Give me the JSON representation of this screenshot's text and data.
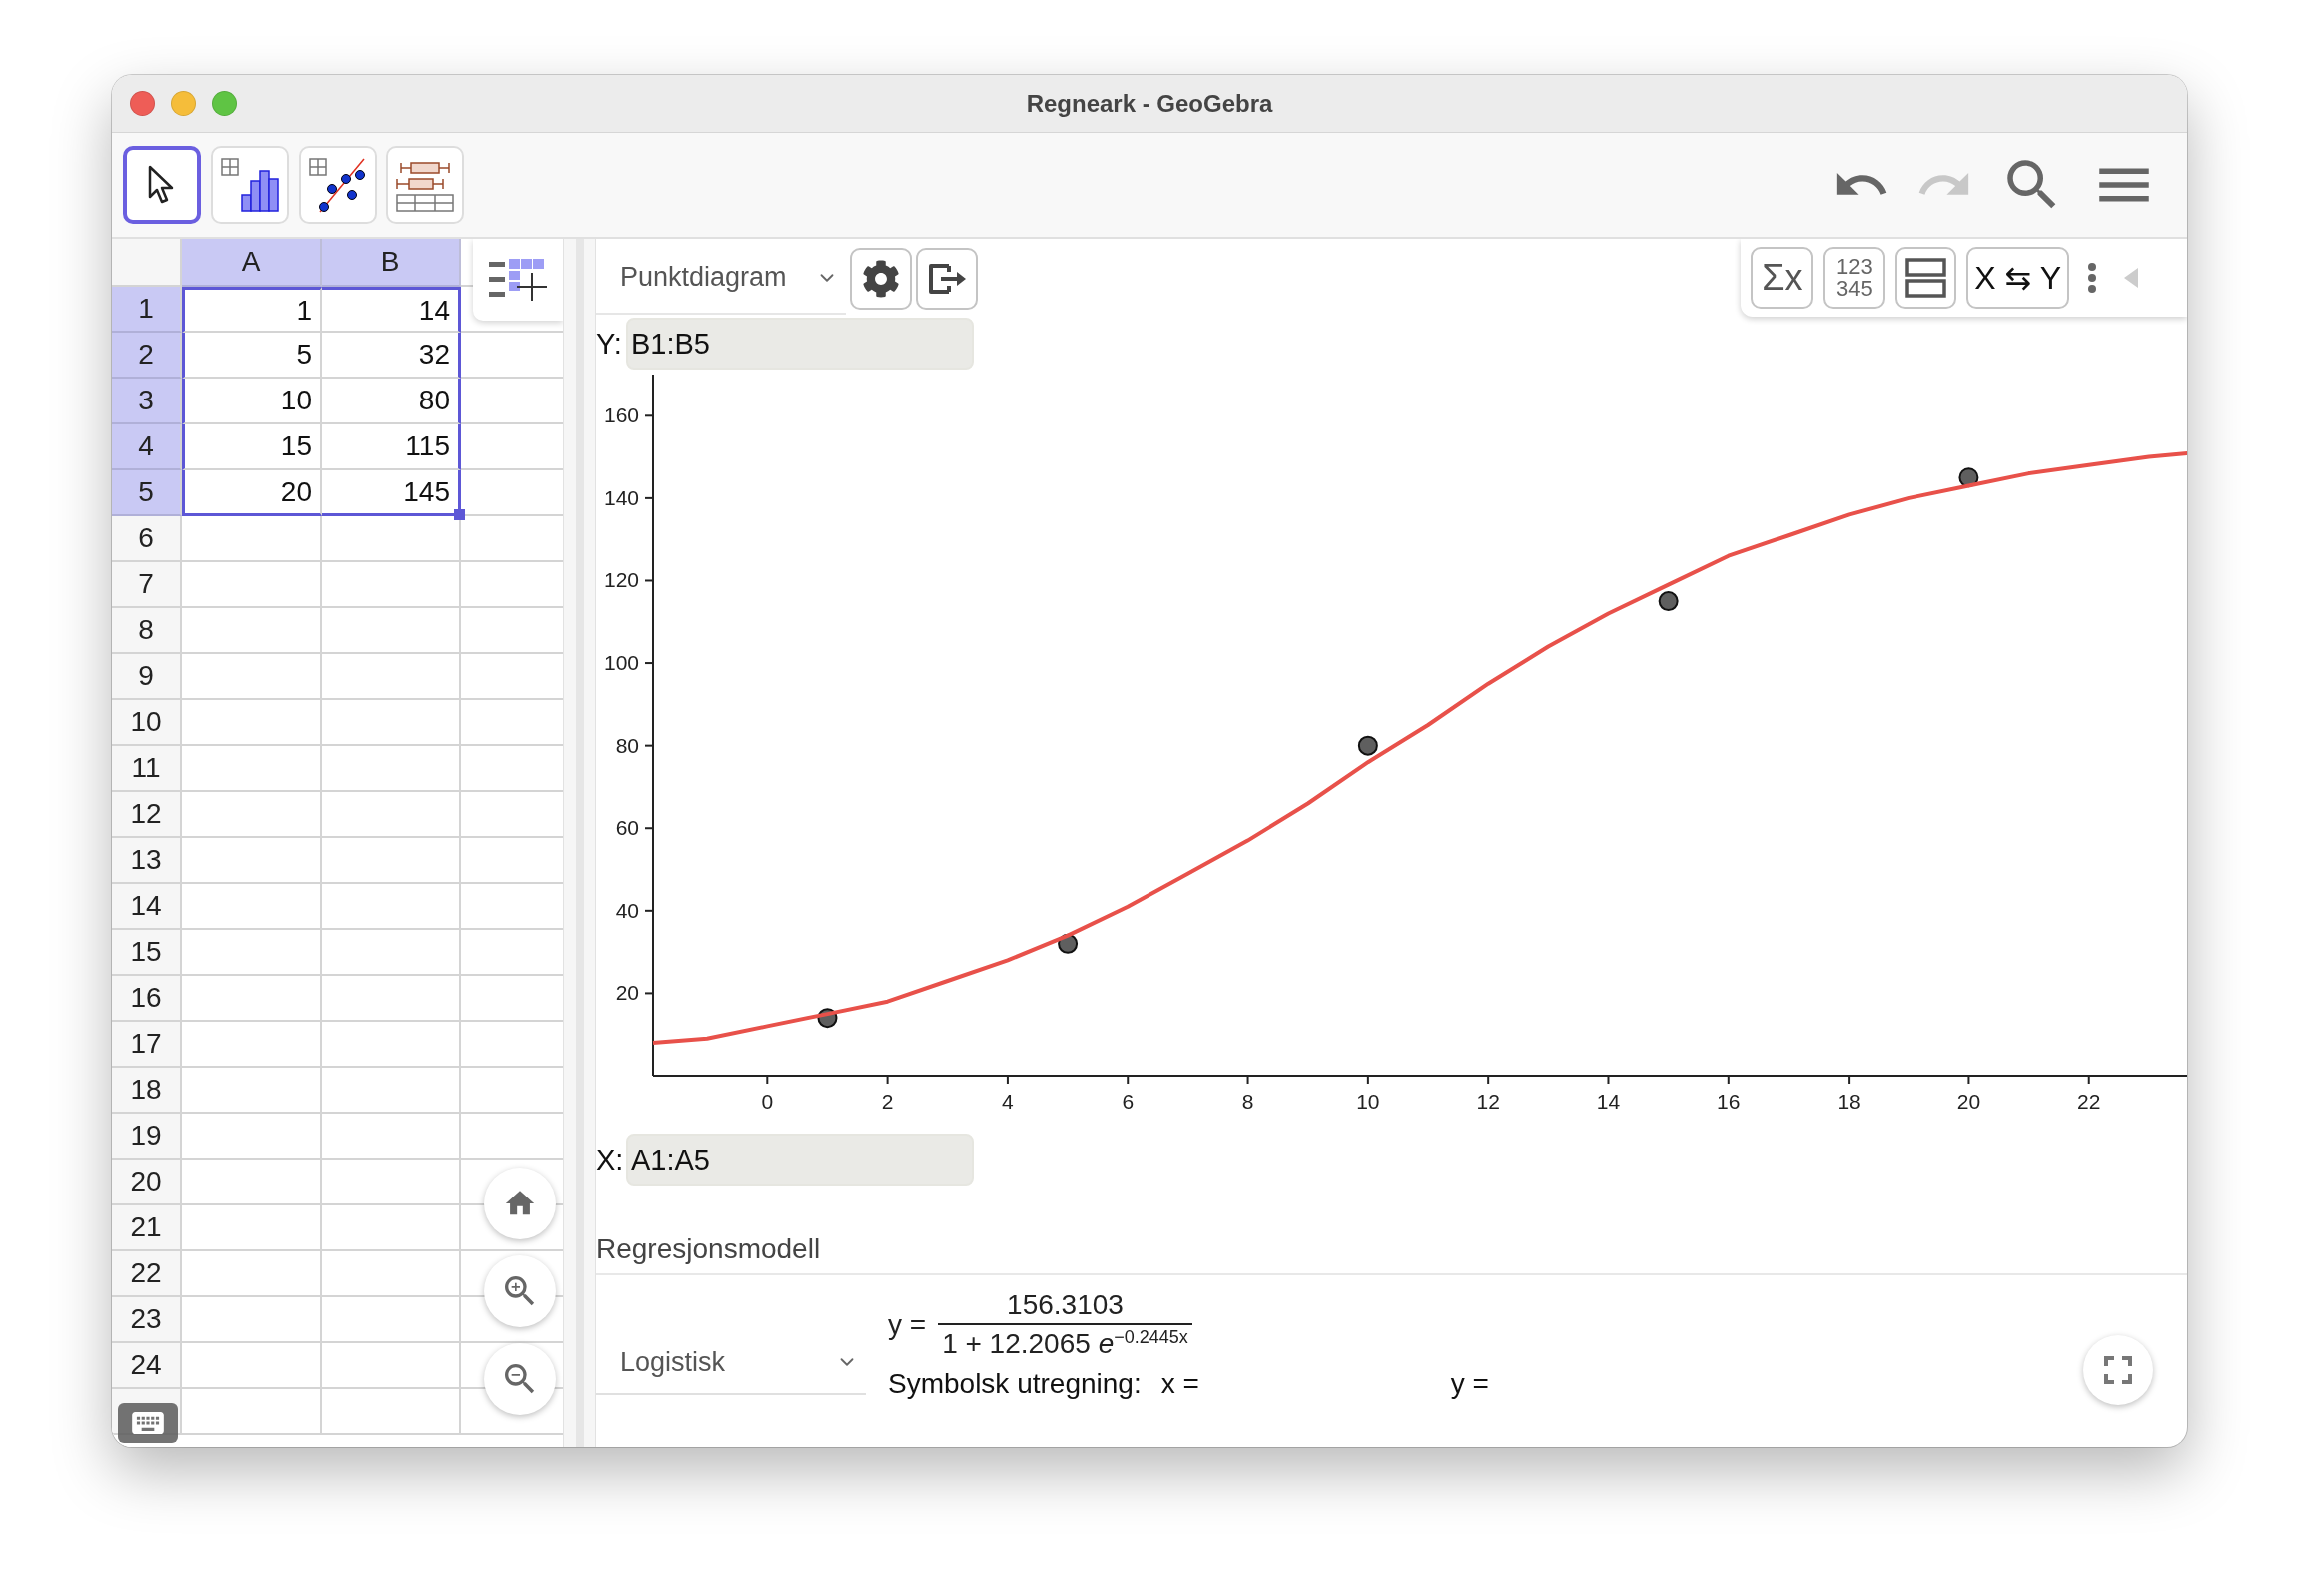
{
  "window": {
    "title": "Regneark - GeoGebra"
  },
  "toolbar": {
    "tools": [
      {
        "kind": "pointer",
        "selected": true
      },
      {
        "kind": "histogram",
        "selected": false
      },
      {
        "kind": "scatter",
        "selected": false
      },
      {
        "kind": "boxplot",
        "selected": false
      }
    ],
    "actions": [
      {
        "kind": "undo",
        "disabled": false
      },
      {
        "kind": "redo",
        "disabled": true
      },
      {
        "kind": "search",
        "disabled": false
      },
      {
        "kind": "menu",
        "disabled": false
      }
    ]
  },
  "spreadsheet": {
    "columns": [
      {
        "label": "A",
        "selected": true
      },
      {
        "label": "B",
        "selected": true
      }
    ],
    "rows": [
      {
        "label": "1",
        "selected": true,
        "cells": [
          "1",
          "14"
        ]
      },
      {
        "label": "2",
        "selected": true,
        "cells": [
          "5",
          "32"
        ]
      },
      {
        "label": "3",
        "selected": true,
        "cells": [
          "10",
          "80"
        ]
      },
      {
        "label": "4",
        "selected": true,
        "cells": [
          "15",
          "115"
        ]
      },
      {
        "label": "5",
        "selected": true,
        "cells": [
          "20",
          "145"
        ]
      },
      {
        "label": "6",
        "selected": false
      },
      {
        "label": "7",
        "selected": false
      },
      {
        "label": "8",
        "selected": false
      },
      {
        "label": "9",
        "selected": false
      },
      {
        "label": "10",
        "selected": false
      },
      {
        "label": "11",
        "selected": false
      },
      {
        "label": "12",
        "selected": false
      },
      {
        "label": "13",
        "selected": false
      },
      {
        "label": "14",
        "selected": false
      },
      {
        "label": "15",
        "selected": false
      },
      {
        "label": "16",
        "selected": false
      },
      {
        "label": "17",
        "selected": false
      },
      {
        "label": "18",
        "selected": false
      },
      {
        "label": "19",
        "selected": false
      },
      {
        "label": "20",
        "selected": false
      },
      {
        "label": "21",
        "selected": false
      },
      {
        "label": "22",
        "selected": false
      },
      {
        "label": "23",
        "selected": false
      },
      {
        "label": "24",
        "selected": false
      }
    ]
  },
  "graphics": {
    "plot_type": "Punktdiagram",
    "stat_buttons": {
      "sigma": "Σx",
      "data_lines": [
        "123",
        "345"
      ],
      "swap": "X ⇆ Y"
    },
    "y_field": {
      "label": "Y:",
      "value": "B1:B5"
    },
    "x_field": {
      "label": "X:",
      "value": "A1:A5"
    },
    "chart_data": {
      "type": "scatter",
      "x": [
        1,
        5,
        10,
        15,
        20
      ],
      "series": [
        {
          "color": "#5f5f5f",
          "values": [
            14,
            32,
            80,
            115,
            145
          ]
        }
      ],
      "xlim": [
        -1.9,
        23.7
      ],
      "ylim": [
        0,
        170
      ],
      "xticks": [
        0,
        2,
        4,
        6,
        8,
        10,
        12,
        14,
        16,
        18,
        20,
        22
      ],
      "yticks": [
        20,
        40,
        60,
        80,
        100,
        120,
        140,
        160
      ]
    },
    "regression_curve": {
      "chart_data": {
        "type": "line",
        "x": [
          -1.9,
          -1,
          0,
          1,
          2,
          3,
          4,
          5,
          6,
          7,
          8,
          9,
          10,
          11,
          12,
          13,
          14,
          15,
          16,
          17,
          18,
          19,
          20,
          21,
          22,
          23,
          23.7
        ],
        "series": [
          {
            "color": "#e8514a",
            "values": [
              8,
              9,
              12,
              15,
              18,
              23,
              28,
              34,
              41,
              49,
              57,
              66,
              76,
              85,
              95,
              104,
              112,
              119,
              126,
              131,
              136,
              140,
              143,
              146,
              148,
              150,
              151
            ]
          }
        ],
        "xlim": [
          -1.9,
          23.7
        ],
        "ylim": [
          0,
          170
        ]
      }
    }
  },
  "regression": {
    "title": "Regresjonsmodell",
    "model": "Logistisk",
    "equation": {
      "lhs": "y =",
      "numerator": "156.3103",
      "denominator": "1 + 12.2065 *e*$^{−0.2445x}$"
    },
    "symbolic": {
      "label": "Symbolsk utregning:",
      "x": "x =",
      "y": "y ="
    }
  }
}
